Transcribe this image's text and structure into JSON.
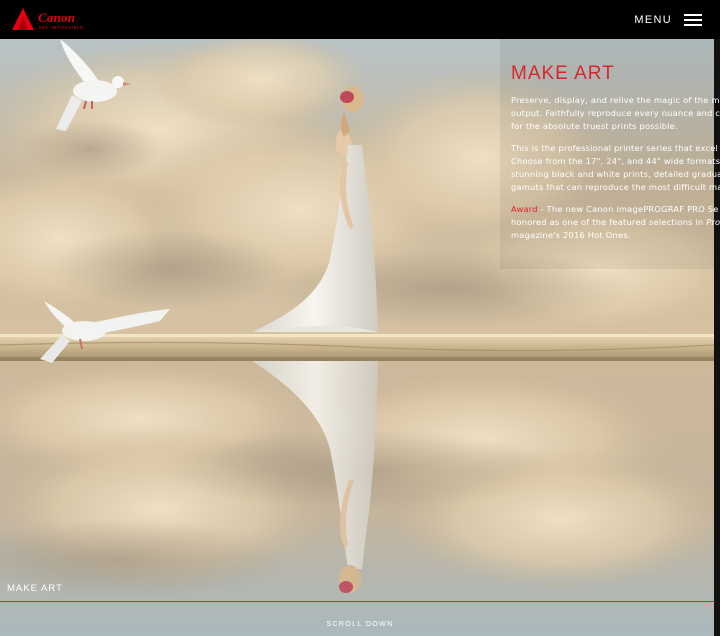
{
  "brand": {
    "name": "Canon",
    "tagline": "SEE IMPOSSIBLE",
    "color": "#e3000f"
  },
  "header": {
    "menu_label": "MENU"
  },
  "hero": {
    "title": "MAKE ART",
    "paragraph1": [
      "Preserve, display, and relive the magic of the m",
      "output. Faithfully reproduce every nuance and c",
      "for the absolute truest prints possible."
    ],
    "paragraph2": [
      "This is the professional printer series that excel",
      "Choose from the 17\", 24\", and 44\" wide formats",
      "stunning black and white prints, detailed gradua",
      "gamuts that can reproduce the most difficult ma"
    ],
    "award": {
      "label": "Award",
      "line1_rest": " - The new Canon imagePROGRAF PRO Se",
      "line2_text": "honored as one of the featured selections in ",
      "line2_italic": "Pro",
      "line3": "magazine's 2016 Hot Ones."
    }
  },
  "footer": {
    "section_label": "MAKE ART",
    "scroll_label": "SCROLL DOWN",
    "accent": "#d9262e"
  }
}
